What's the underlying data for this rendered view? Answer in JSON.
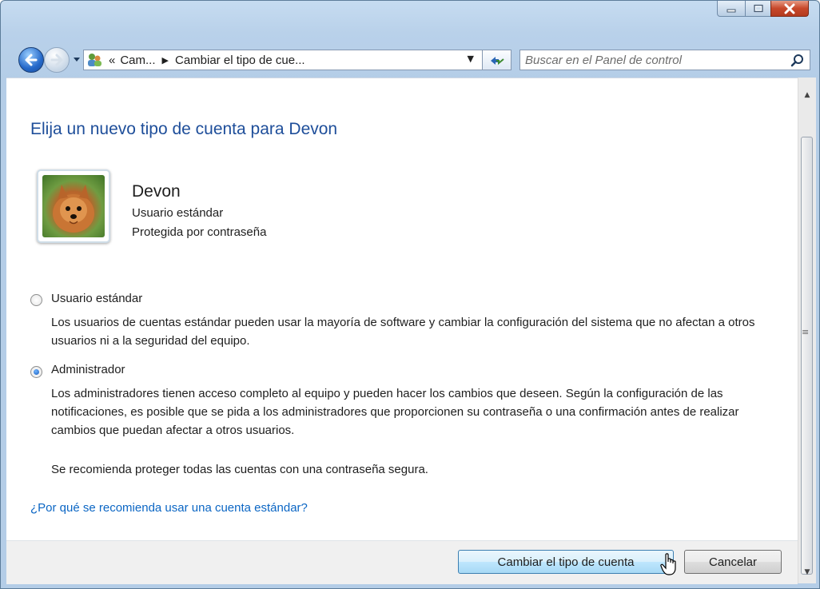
{
  "window": {
    "controls": {
      "minimize": "minimize-icon",
      "maximize": "maximize-icon",
      "close": "close-icon"
    }
  },
  "navbar": {
    "breadcrumb": [
      "Cam...",
      "Cambiar el tipo de cue..."
    ],
    "breadcrumb_prefix": "«",
    "search_placeholder": "Buscar en el Panel de control"
  },
  "page": {
    "title": "Elija un nuevo tipo de cuenta para Devon",
    "user": {
      "name": "Devon",
      "type": "Usuario estándar",
      "protection": "Protegida por contraseña"
    },
    "options": [
      {
        "label": "Usuario estándar",
        "selected": false,
        "description": "Los usuarios de cuentas estándar pueden usar la mayoría de software y cambiar la configuración del sistema que no afectan a otros usuarios ni a la seguridad del equipo."
      },
      {
        "label": "Administrador",
        "selected": true,
        "description": "Los administradores tienen acceso completo al equipo y pueden hacer los cambios que deseen. Según la configuración de las notificaciones, es posible que se pida a los administradores que proporcionen su contraseña o una confirmación antes de realizar cambios que puedan afectar a otros usuarios.",
        "note": "Se recomienda proteger todas las cuentas con una contraseña segura."
      }
    ],
    "help_link": "¿Por qué se recomienda usar una cuenta estándar?"
  },
  "footer": {
    "change_button": "Cambiar el tipo de cuenta",
    "cancel_button": "Cancelar"
  }
}
